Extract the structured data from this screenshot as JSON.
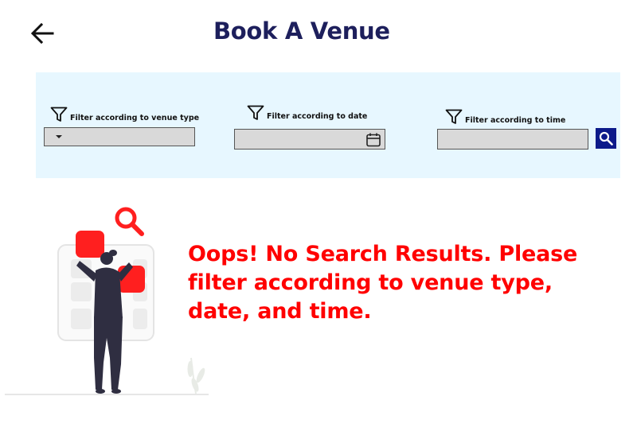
{
  "header": {
    "title": "Book A Venue",
    "back_icon": "arrow-left-icon"
  },
  "filters": {
    "venue_type": {
      "label": "Filter according to venue type",
      "value": "",
      "icon": "filter-icon"
    },
    "date": {
      "label": "Filter according to date",
      "value": "",
      "icon": "filter-icon",
      "field_icon": "calendar-icon"
    },
    "time": {
      "label": "Filter according to time",
      "value": "",
      "icon": "filter-icon"
    },
    "search_icon": "search-icon"
  },
  "empty_state": {
    "message": "Oops! No Search Results. Please filter according to venue type, date, and time.",
    "illustration": "person-searching-illustration"
  },
  "colors": {
    "title": "#1d1f5c",
    "panel_bg": "#e7f7ff",
    "field_bg": "#d9d9d9",
    "search_button": "#0c1a8a",
    "message": "#ff0000"
  }
}
